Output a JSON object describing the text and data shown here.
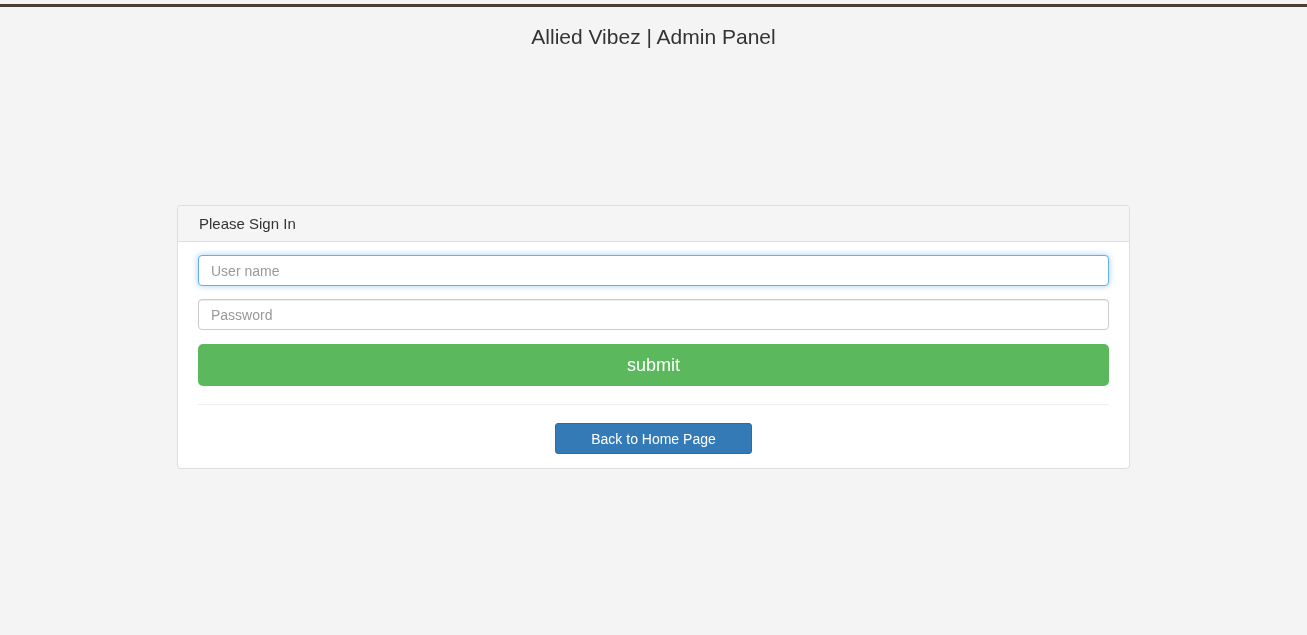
{
  "page": {
    "title": "Allied Vibez | Admin Panel"
  },
  "login_panel": {
    "heading": "Please Sign In",
    "fields": [
      {
        "placeholder": "User name",
        "focused": true
      },
      {
        "placeholder": "Password",
        "focused": false
      }
    ],
    "submit_button": "submit",
    "back_button": "Back to Home Page"
  }
}
